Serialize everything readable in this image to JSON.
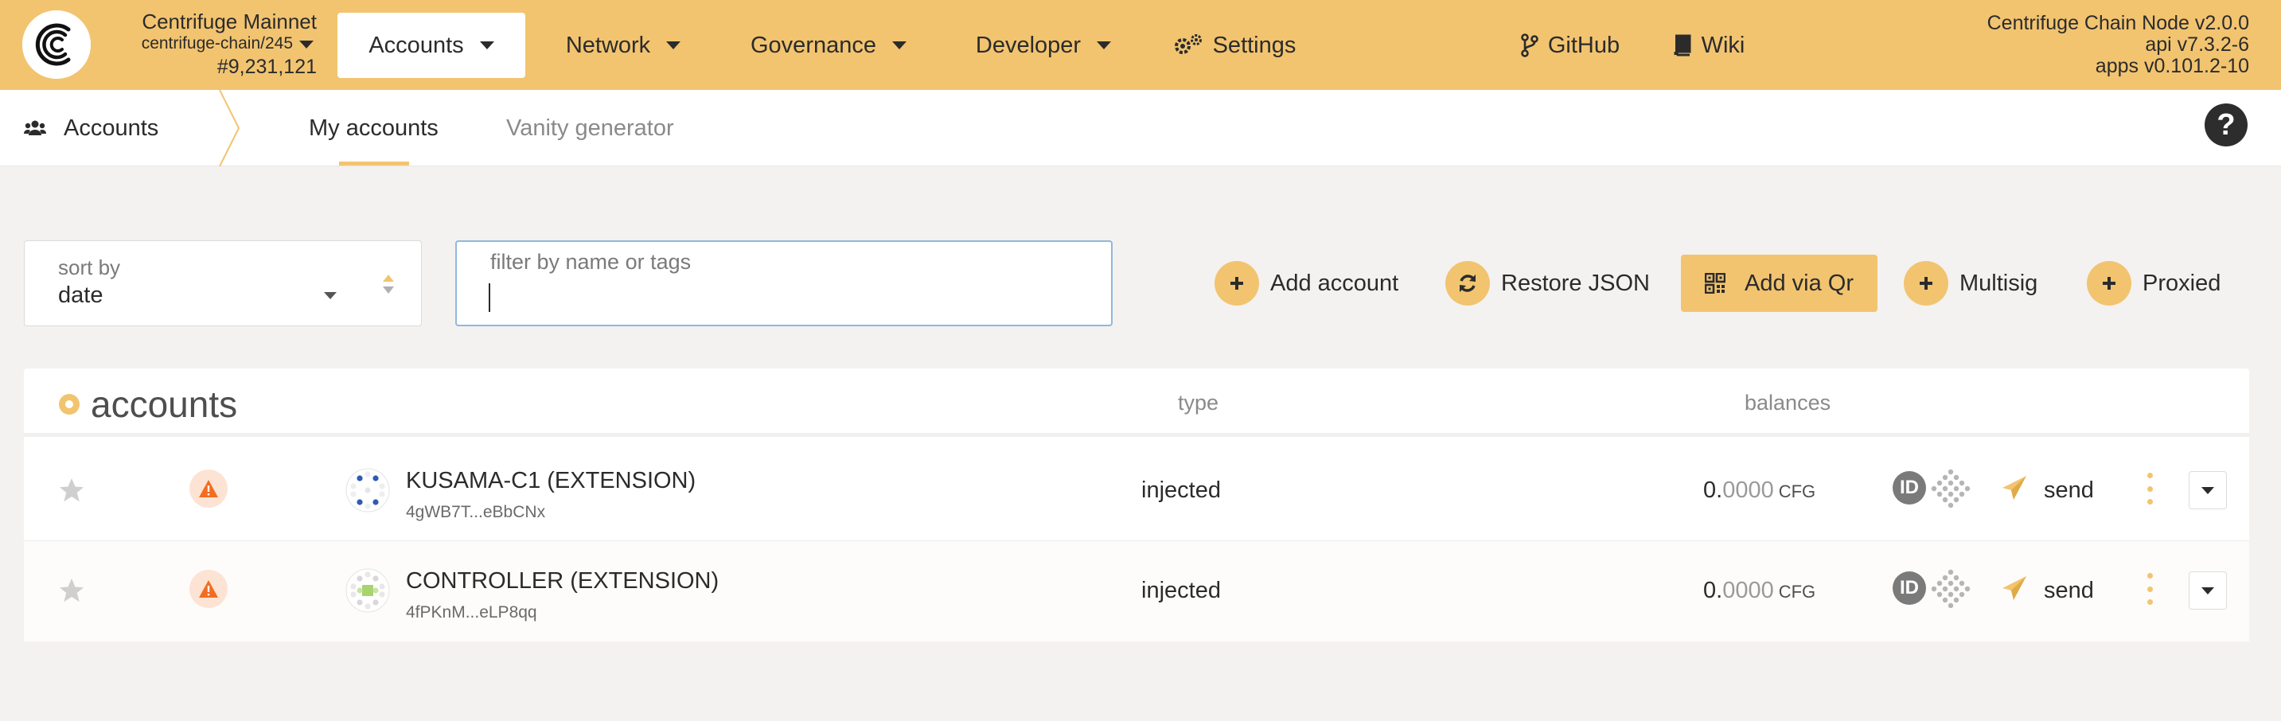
{
  "colors": {
    "accent": "#f2c470",
    "background": "#f4f2f0",
    "text": "#2b2b2b",
    "muted": "#8a8a8a",
    "warning": "#f26d21",
    "focus_border": "#8fb8de"
  },
  "header": {
    "logo_icon": "centrifuge-logo-icon",
    "chain_name": "Centrifuge Mainnet",
    "chain_spec": "centrifuge-chain/245",
    "block_number": "#9,231,121",
    "nav": [
      {
        "label": "Accounts",
        "icon": "chevron-down-icon",
        "active": true
      },
      {
        "label": "Network",
        "icon": "chevron-down-icon"
      },
      {
        "label": "Governance",
        "icon": "chevron-down-icon"
      },
      {
        "label": "Developer",
        "icon": "chevron-down-icon"
      },
      {
        "label": "Settings",
        "icon": "gears-icon"
      },
      {
        "label": "GitHub",
        "icon": "code-branch-icon"
      },
      {
        "label": "Wiki",
        "icon": "book-icon"
      }
    ],
    "version_lines": [
      "Centrifuge Chain Node v2.0.0",
      "api v7.3.2-6",
      "apps v0.101.2-10"
    ]
  },
  "subnav": {
    "title": "Accounts",
    "title_icon": "users-icon",
    "tabs": [
      {
        "label": "My accounts",
        "active": true
      },
      {
        "label": "Vanity generator",
        "active": false
      }
    ],
    "help_icon": "question-circle-icon",
    "help_label": "?"
  },
  "controls": {
    "sort_label": "sort by",
    "sort_value": "date",
    "filter_placeholder": "filter by name or tags",
    "filter_value": "",
    "buttons": [
      {
        "label": "Add account",
        "icon": "plus-icon"
      },
      {
        "label": "Restore JSON",
        "icon": "sync-icon"
      },
      {
        "label": "Add via Qr",
        "icon": "qrcode-icon"
      },
      {
        "label": "Multisig",
        "icon": "plus-icon"
      },
      {
        "label": "Proxied",
        "icon": "plus-icon"
      }
    ]
  },
  "table": {
    "title": "accounts",
    "columns": {
      "type": "type",
      "balances": "balances"
    },
    "rows": [
      {
        "name": "KUSAMA-C1 (EXTENSION)",
        "address": "4gWB7T...eBbCNx",
        "type": "injected",
        "balance_int": "0.",
        "balance_dec": "0000",
        "balance_unit": "CFG",
        "id_label": "ID",
        "send_label": "send"
      },
      {
        "name": "CONTROLLER (EXTENSION)",
        "address": "4fPKnM...eLP8qq",
        "type": "injected",
        "balance_int": "0.",
        "balance_dec": "0000",
        "balance_unit": "CFG",
        "id_label": "ID",
        "send_label": "send"
      }
    ]
  }
}
